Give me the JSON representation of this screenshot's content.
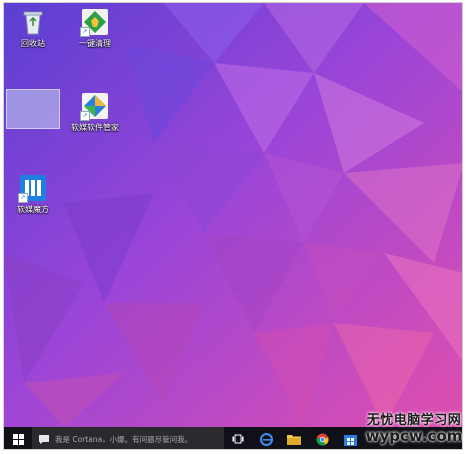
{
  "desktop": {
    "icons": [
      {
        "label": "回收站",
        "icon": "recycle-bin-icon"
      },
      {
        "label": "一键清理",
        "icon": "broom-cleanup-icon"
      },
      {
        "label": "软媒软件管家",
        "icon": "software-manager-icon"
      },
      {
        "label": "软媒魔方",
        "icon": "rubik-cube-icon"
      }
    ],
    "colors": {
      "wallpaper_top": "#6a4fd8",
      "wallpaper_mid": "#a24ad6",
      "wallpaper_bottom": "#e04fae"
    }
  },
  "taskbar": {
    "start_icon": "windows-logo-icon",
    "search_placeholder": "我是 Cortana，小娜。有问题尽管问我。",
    "apps": [
      {
        "name": "task-view",
        "icon": "task-view-icon"
      },
      {
        "name": "edge",
        "icon": "edge-browser-icon"
      },
      {
        "name": "file-explorer",
        "icon": "folder-icon"
      },
      {
        "name": "chrome",
        "icon": "chrome-icon"
      },
      {
        "name": "store",
        "icon": "store-icon"
      }
    ],
    "colors": {
      "background": "#101018",
      "search": "#2a2a2e"
    }
  },
  "watermark": {
    "line1": "无忧电脑学习网",
    "line2": "wypcw.com"
  }
}
